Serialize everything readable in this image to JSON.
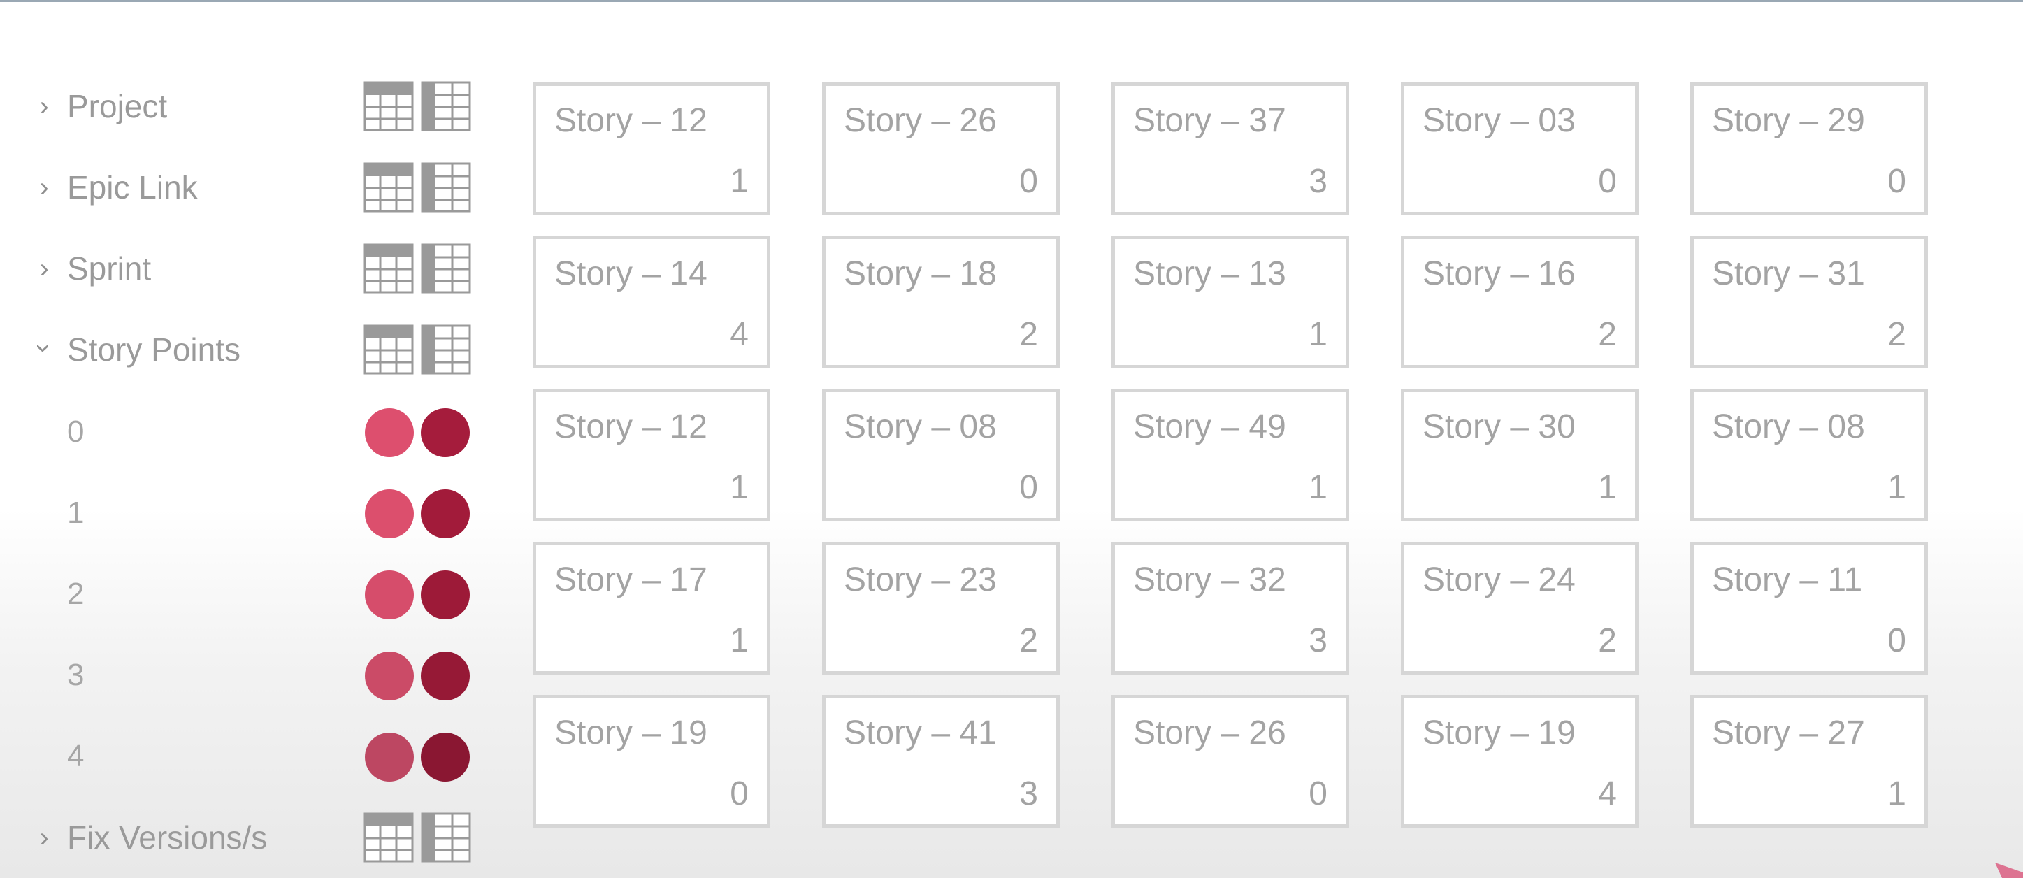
{
  "sidebar": {
    "groups": [
      {
        "label": "Project",
        "expanded": false
      },
      {
        "label": "Epic Link",
        "expanded": false
      },
      {
        "label": "Sprint",
        "expanded": false
      },
      {
        "label": "Story Points",
        "expanded": true
      },
      {
        "label": "Fix Versions/s",
        "expanded": false
      }
    ],
    "story_point_values": [
      {
        "label": "0",
        "color_light": "#dd4f6e",
        "color_dark": "#a51c3c"
      },
      {
        "label": "1",
        "color_light": "#dc4f6d",
        "color_dark": "#a21b3a"
      },
      {
        "label": "2",
        "color_light": "#d64d6b",
        "color_dark": "#9d1a38"
      },
      {
        "label": "3",
        "color_light": "#cb4b67",
        "color_dark": "#961936"
      },
      {
        "label": "4",
        "color_light": "#bd4762",
        "color_dark": "#8a1732"
      }
    ],
    "icons": {
      "chevron": "chevron-right-icon",
      "view_a": "table-view-icon",
      "view_b": "column-view-icon"
    }
  },
  "cards": [
    [
      {
        "name": "Story – 12",
        "points": "1"
      },
      {
        "name": "Story – 26",
        "points": "0"
      },
      {
        "name": "Story – 37",
        "points": "3"
      },
      {
        "name": "Story – 03",
        "points": "0"
      },
      {
        "name": "Story – 29",
        "points": "0"
      }
    ],
    [
      {
        "name": "Story – 14",
        "points": "4"
      },
      {
        "name": "Story – 18",
        "points": "2"
      },
      {
        "name": "Story – 13",
        "points": "1"
      },
      {
        "name": "Story – 16",
        "points": "2"
      },
      {
        "name": "Story – 31",
        "points": "2"
      }
    ],
    [
      {
        "name": "Story – 12",
        "points": "1"
      },
      {
        "name": "Story – 08",
        "points": "0"
      },
      {
        "name": "Story – 49",
        "points": "1"
      },
      {
        "name": "Story – 30",
        "points": "1"
      },
      {
        "name": "Story – 08",
        "points": "1"
      }
    ],
    [
      {
        "name": "Story – 17",
        "points": "1"
      },
      {
        "name": "Story – 23",
        "points": "2"
      },
      {
        "name": "Story – 32",
        "points": "3"
      },
      {
        "name": "Story – 24",
        "points": "2"
      },
      {
        "name": "Story – 11",
        "points": "0"
      }
    ],
    [
      {
        "name": "Story – 19",
        "points": "0"
      },
      {
        "name": "Story – 41",
        "points": "3"
      },
      {
        "name": "Story – 26",
        "points": "0"
      },
      {
        "name": "Story – 19",
        "points": "4"
      },
      {
        "name": "Story – 27",
        "points": "1"
      }
    ]
  ]
}
